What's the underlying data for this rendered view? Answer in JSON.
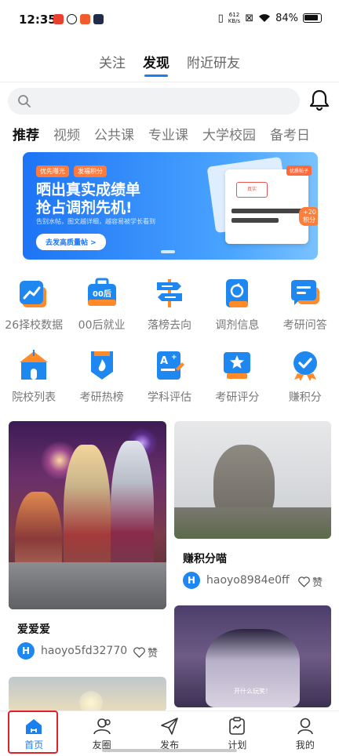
{
  "status_bar": {
    "time": "12:35",
    "net_speed": "612",
    "net_unit": "KB/s",
    "battery": "84%"
  },
  "top_tabs": [
    {
      "label": "关注",
      "active": false
    },
    {
      "label": "发现",
      "active": true
    },
    {
      "label": "附近研友",
      "active": false
    }
  ],
  "categories": [
    {
      "label": "推荐",
      "active": true
    },
    {
      "label": "视频"
    },
    {
      "label": "公共课"
    },
    {
      "label": "专业课"
    },
    {
      "label": "大学校园"
    },
    {
      "label": "备考日"
    }
  ],
  "banner": {
    "chip1": "优先曝光",
    "chip2": "发福积分",
    "line1": "晒出真实成绩单",
    "line2": "抢占调剂先机!",
    "sub": "告别水帖，图文越详细，越容易被学长看到",
    "cta": "去发高质量帖 >",
    "stamp": "真实",
    "tag": "优质帖子",
    "points": "+20 积分"
  },
  "grid": [
    {
      "label": "26择校数据",
      "icon": "trend-chart-icon",
      "color": "#1f88f0"
    },
    {
      "label": "00后就业",
      "icon": "briefcase-icon",
      "color": "#1f88f0"
    },
    {
      "label": "落榜去向",
      "icon": "signpost-icon",
      "color": "#1f88f0"
    },
    {
      "label": "调剂信息",
      "icon": "swap-document-icon",
      "color": "#1f88f0"
    },
    {
      "label": "考研问答",
      "icon": "chat-bubble-icon",
      "color": "#1f88f0"
    },
    {
      "label": "院校列表",
      "icon": "school-building-icon",
      "color": "#1f88f0"
    },
    {
      "label": "考研热榜",
      "icon": "hot-badge-icon",
      "color": "#1f88f0"
    },
    {
      "label": "学科评估",
      "icon": "grade-document-icon",
      "color": "#1f88f0"
    },
    {
      "label": "考研评分",
      "icon": "star-board-icon",
      "color": "#1f88f0"
    },
    {
      "label": "赚积分",
      "icon": "check-circle-icon",
      "color": "#1f88f0"
    }
  ],
  "feed": [
    {
      "title": "爱爱爱",
      "author": "haoyo5fd32770",
      "like": "赞"
    },
    {
      "title": "赚积分喵",
      "author": "haoyo8984e0ff",
      "like": "赞"
    },
    {
      "caption": "开什么玩笑！"
    }
  ],
  "avatar_letter": "H",
  "bottom_nav": [
    {
      "label": "首页",
      "icon": "home-icon",
      "active": true
    },
    {
      "label": "友圈",
      "icon": "friends-icon"
    },
    {
      "label": "发布",
      "icon": "send-icon"
    },
    {
      "label": "计划",
      "icon": "plan-icon"
    },
    {
      "label": "我的",
      "icon": "profile-icon"
    }
  ],
  "colors": {
    "accent": "#1a7ff0",
    "icon_orange": "#ff8a2a",
    "highlight": "#e0202a"
  }
}
